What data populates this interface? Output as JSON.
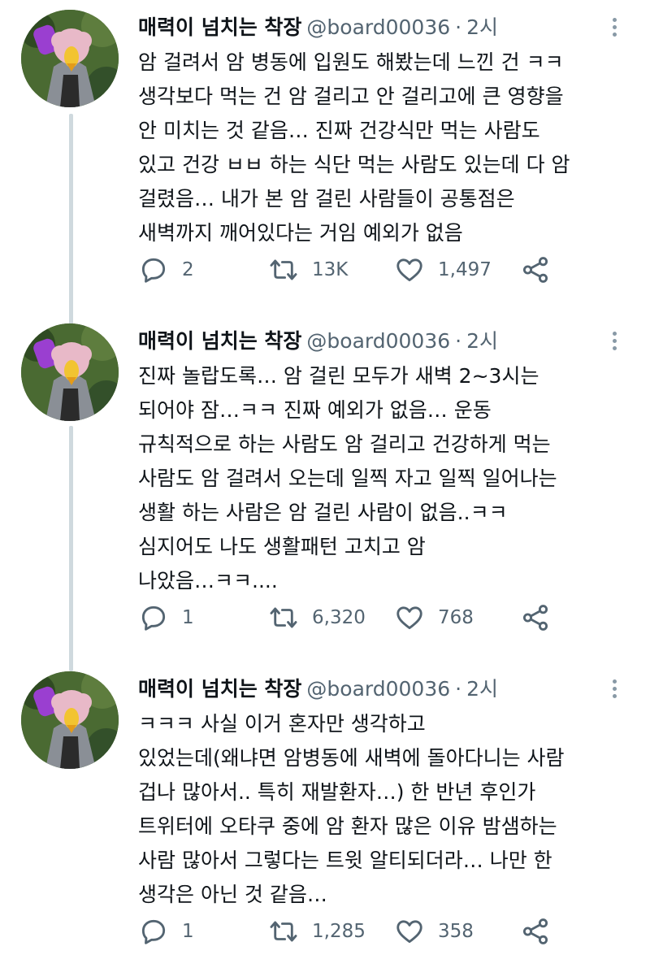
{
  "author": {
    "name": "매력이 넘치는 착장",
    "handle": "@board00036",
    "separator": "·",
    "time": "2시"
  },
  "tweets": [
    {
      "lines": [
        "암 걸려서 암 병동에 입원도 해봤는데 느낀 건 ㅋㅋ",
        "생각보다 먹는 건 암 걸리고 안 걸리고에 큰 영향을",
        "안 미치는 것 같음… 진짜 건강식만 먹는 사람도",
        "있고 건강 ㅂㅂ 하는 식단 먹는 사람도 있는데 다 암",
        "걸렸음… 내가 본 암 걸린 사람들이 공통점은",
        "새벽까지 깨어있다는 거임 예외가 없음"
      ],
      "replies": "2",
      "retweets": "13K",
      "likes": "1,497"
    },
    {
      "lines": [
        "진짜 놀랍도록… 암 걸린 모두가 새벽 2~3시는",
        "되어야 잠…ㅋㅋ 진짜 예외가 없음… 운동",
        "규칙적으로 하는 사람도 암 걸리고 건강하게 먹는",
        "사람도 암 걸려서 오는데 일찍 자고 일찍 일어나는",
        "생활 하는 사람은 암 걸린 사람이 없음..ㅋㅋ",
        "심지어도 나도 생활패턴 고치고 암",
        "나았음…ㅋㅋ...."
      ],
      "replies": "1",
      "retweets": "6,320",
      "likes": "768"
    },
    {
      "lines": [
        "ㅋㅋㅋ 사실 이거 혼자만 생각하고",
        "있었는데(왜냐면 암병동에 새벽에 돌아다니는 사람",
        "겁나 많아서.. 특히 재발환자…) 한 반년 후인가",
        "트위터에 오타쿠 중에 암 환자 많은 이유 밤샘하는",
        "사람 많아서 그렇다는 트윗 알티되더라… 나만 한",
        "생각은 아닌 것 같음…"
      ],
      "replies": "1",
      "retweets": "1,285",
      "likes": "358"
    }
  ],
  "icons": {
    "reply": "speech-bubble-icon",
    "retweet": "retweet-arrows-icon",
    "like": "heart-icon",
    "share": "share-nodes-icon",
    "more": "vertical-dots-icon"
  },
  "colors": {
    "text": "#0f1419",
    "muted": "#536471",
    "thread_line": "#cfd9de"
  }
}
